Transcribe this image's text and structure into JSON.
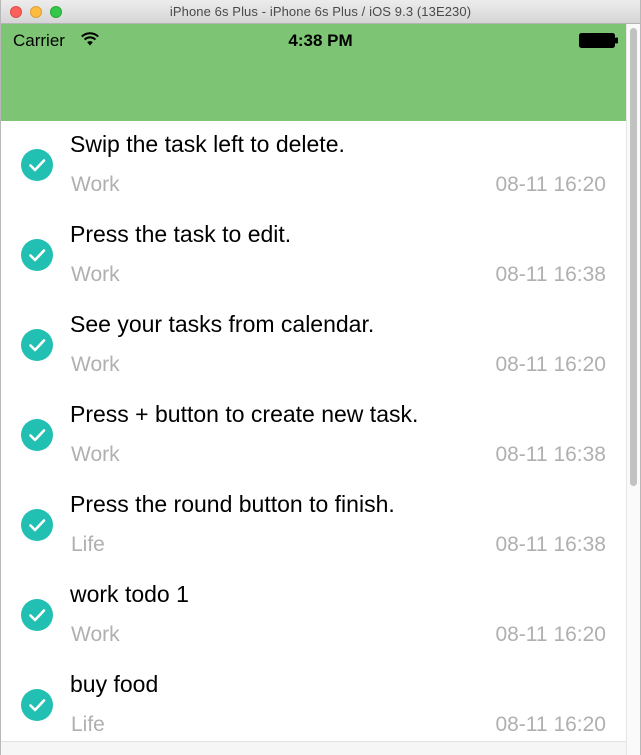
{
  "window": {
    "title": "iPhone 6s Plus - iPhone 6s Plus / iOS 9.3 (13E230)"
  },
  "status_bar": {
    "carrier": "Carrier",
    "time": "4:38 PM",
    "wifi_icon": "wifi-icon",
    "battery_icon": "battery-icon"
  },
  "colors": {
    "nav_green": "#7dc574",
    "check_teal": "#22bfb3",
    "secondary_text": "#b0b0b0"
  },
  "tasks": [
    {
      "title": "Swip the task left to delete.",
      "category": "Work",
      "time": "08-11 16:20",
      "done_icon": "checkmark-circle-icon"
    },
    {
      "title": "Press the task to edit.",
      "category": "Work",
      "time": "08-11 16:38",
      "done_icon": "checkmark-circle-icon"
    },
    {
      "title": "See your tasks from calendar.",
      "category": "Work",
      "time": "08-11 16:20",
      "done_icon": "checkmark-circle-icon"
    },
    {
      "title": "Press + button to create new task.",
      "category": "Work",
      "time": "08-11 16:38",
      "done_icon": "checkmark-circle-icon"
    },
    {
      "title": "Press the round button to finish.",
      "category": "Life",
      "time": "08-11 16:38",
      "done_icon": "checkmark-circle-icon"
    },
    {
      "title": "work todo 1",
      "category": "Work",
      "time": "08-11 16:20",
      "done_icon": "checkmark-circle-icon"
    },
    {
      "title": "buy food",
      "category": "Life",
      "time": "08-11 16:20",
      "done_icon": "checkmark-circle-icon"
    }
  ]
}
